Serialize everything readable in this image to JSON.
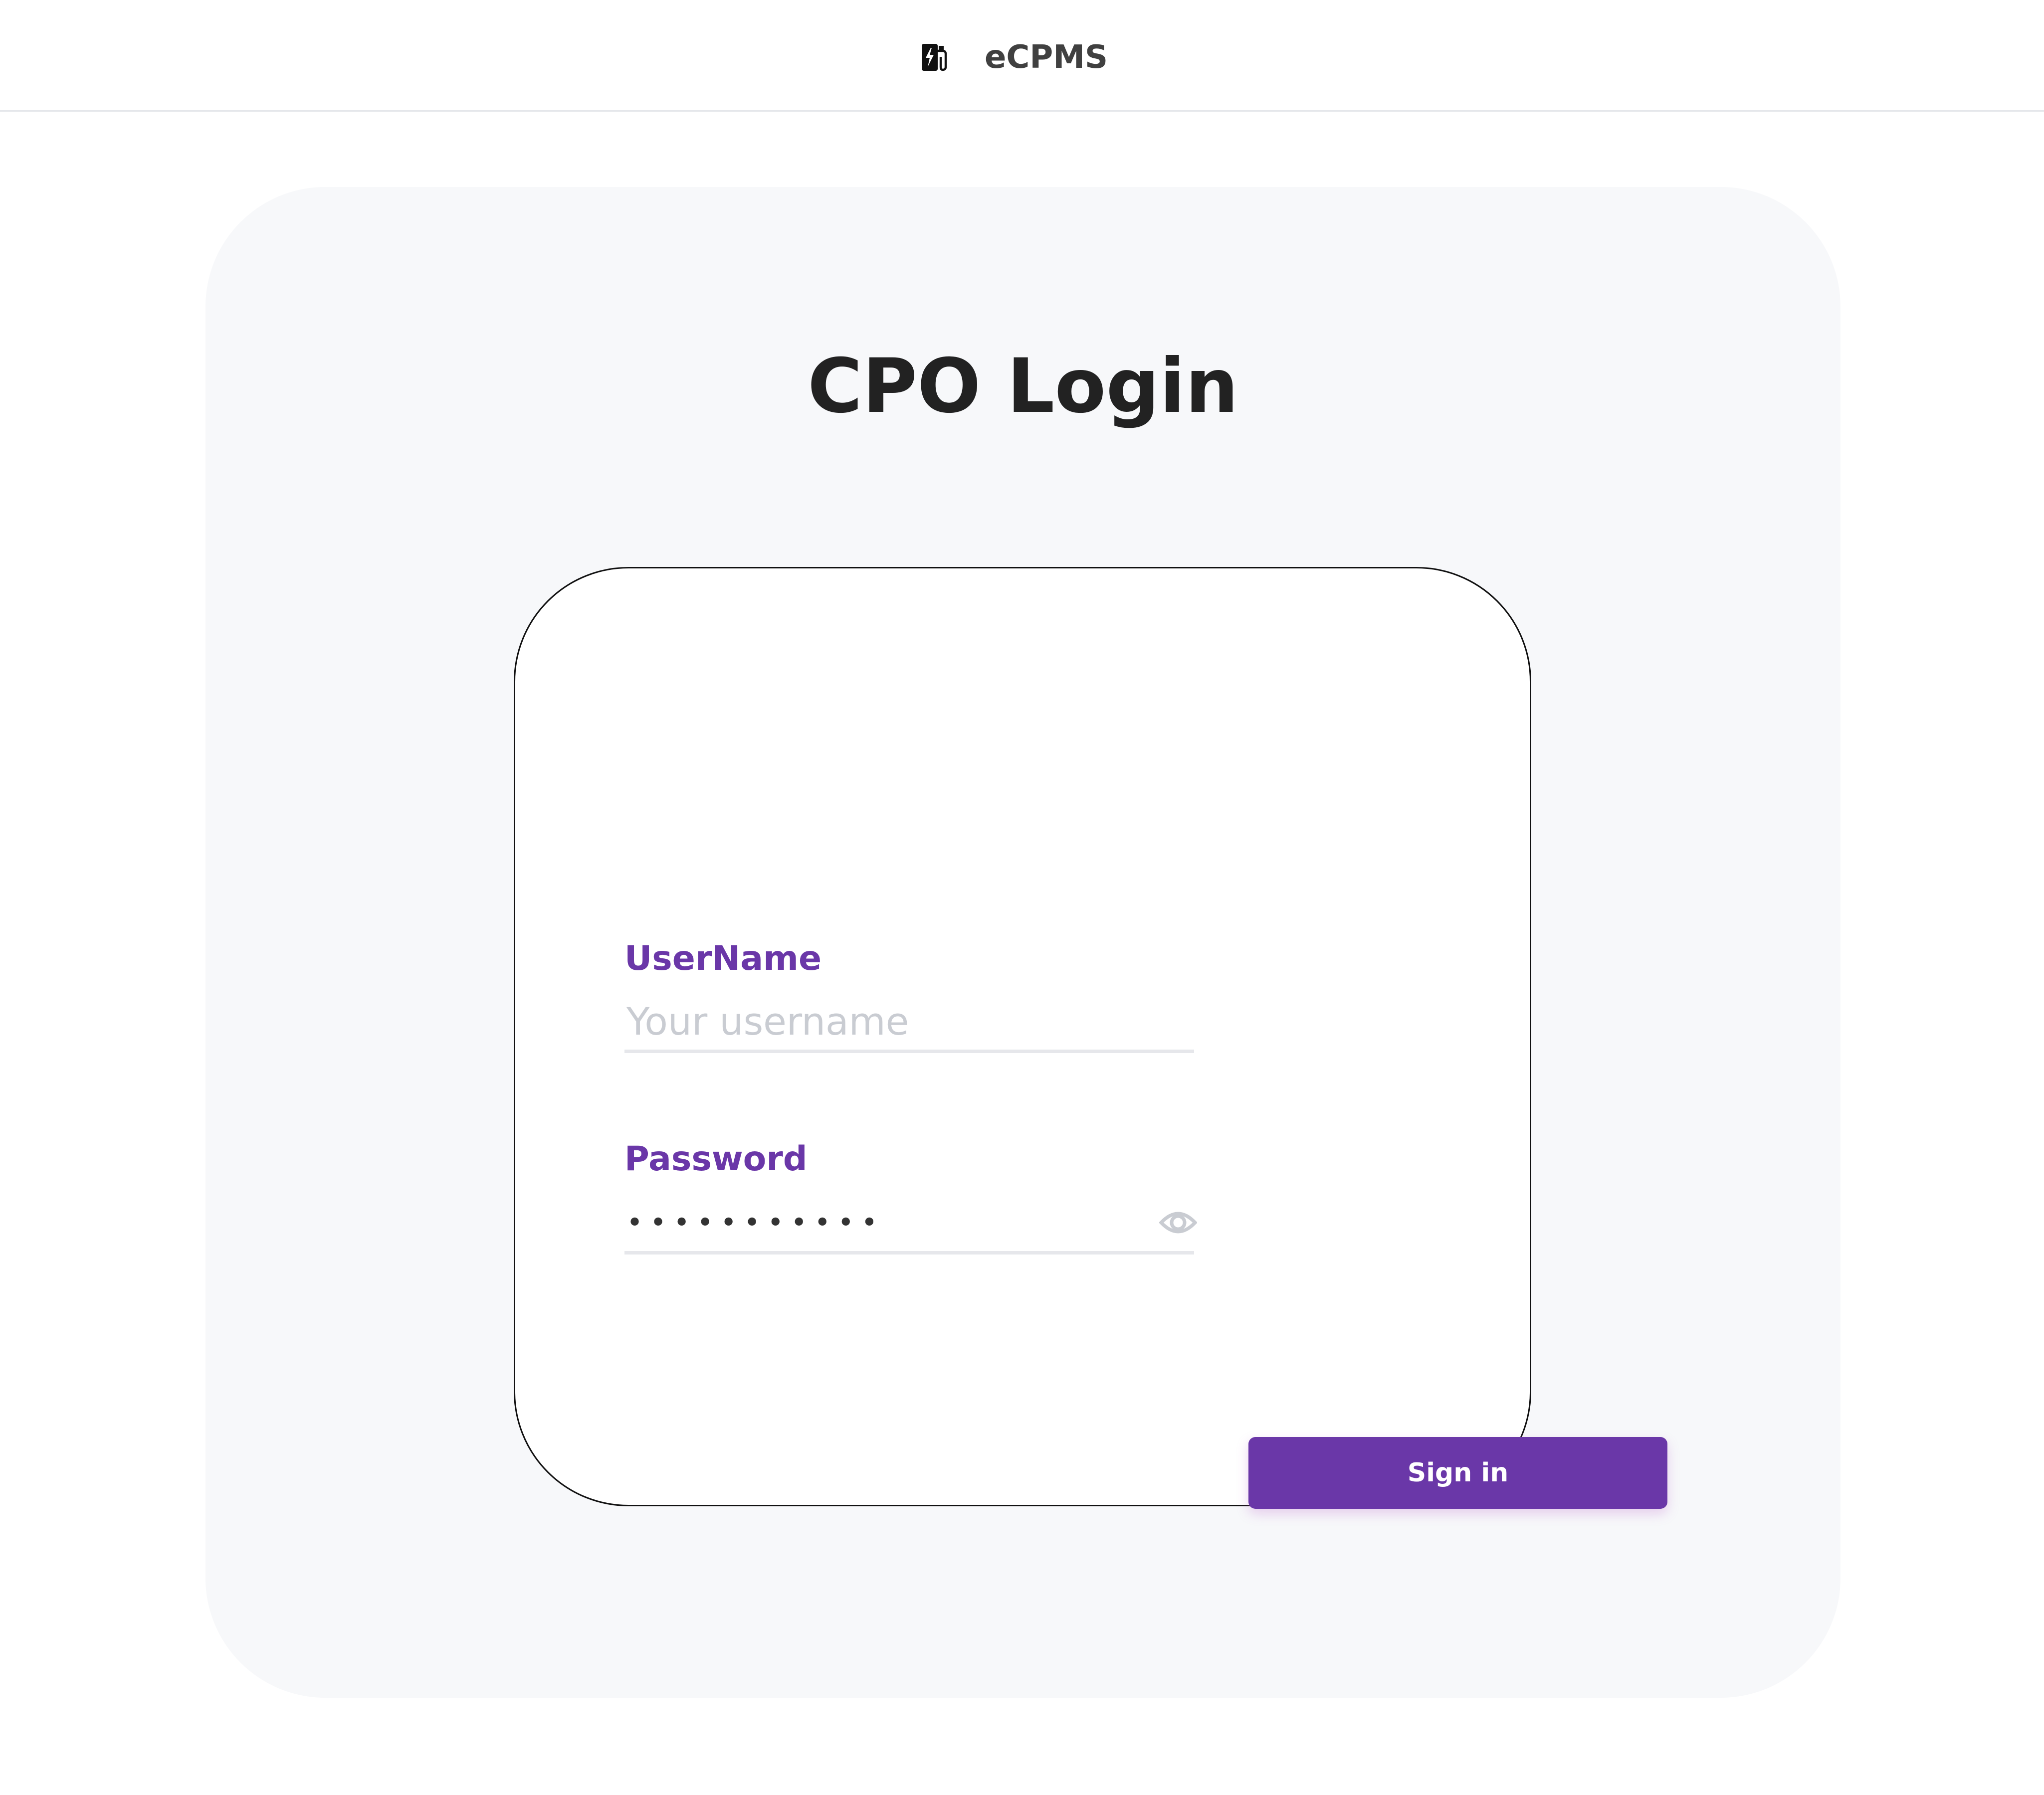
{
  "header": {
    "brand_name": "eCPMS",
    "brand_icon": "ev-charger-icon"
  },
  "main": {
    "title": "CPO Login"
  },
  "form": {
    "username": {
      "label": "UserName",
      "placeholder": "Your username",
      "value": ""
    },
    "password": {
      "label": "Password",
      "value": "•••••••••••",
      "toggle_icon": "eye-icon"
    },
    "submit_label": "Sign in"
  },
  "colors": {
    "accent": "#6a37a8",
    "panel_bg": "#f7f8fa",
    "title": "#222222",
    "placeholder": "#c9ccd2",
    "divider": "#e5e7eb"
  }
}
